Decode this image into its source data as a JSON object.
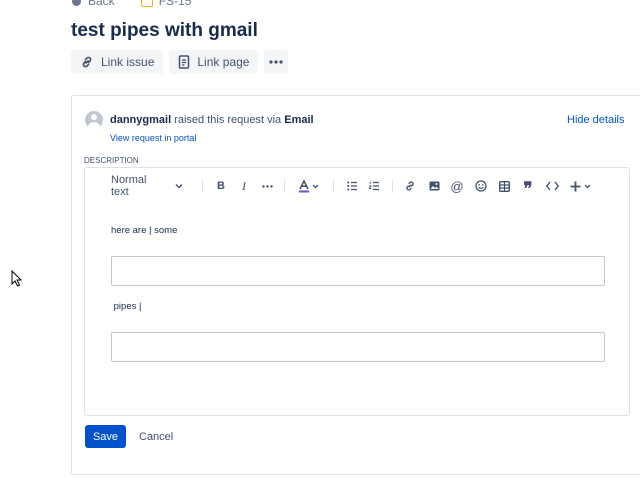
{
  "nav": {
    "back_label": "Back",
    "issue_key": "FS-15"
  },
  "issue": {
    "title": "test pipes with gmail"
  },
  "actions": {
    "link_issue": "Link issue",
    "link_page": "Link page"
  },
  "request": {
    "user": "dannygmail",
    "raised_text": " raised this request via ",
    "channel": "Email",
    "view_link": "View request in portal",
    "hide_details": "Hide details"
  },
  "description": {
    "label": "DESCRIPTION",
    "text_style": "Normal text",
    "toolbar_icons": [
      "bold-icon",
      "italic-icon",
      "more-formatting-icon",
      "text-color-icon",
      "bullet-list-icon",
      "numbered-list-icon",
      "link-icon",
      "image-icon",
      "mention-icon",
      "emoji-icon",
      "table-icon",
      "quote-icon",
      "code-icon",
      "insert-icon"
    ],
    "lines": [
      "here are | some",
      " pipes |"
    ]
  },
  "buttons": {
    "save": "Save",
    "cancel": "Cancel"
  },
  "colors": {
    "primary": "#0052cc",
    "text": "#172b4d",
    "subtle": "#42526e",
    "border": "#dfe1e6"
  }
}
